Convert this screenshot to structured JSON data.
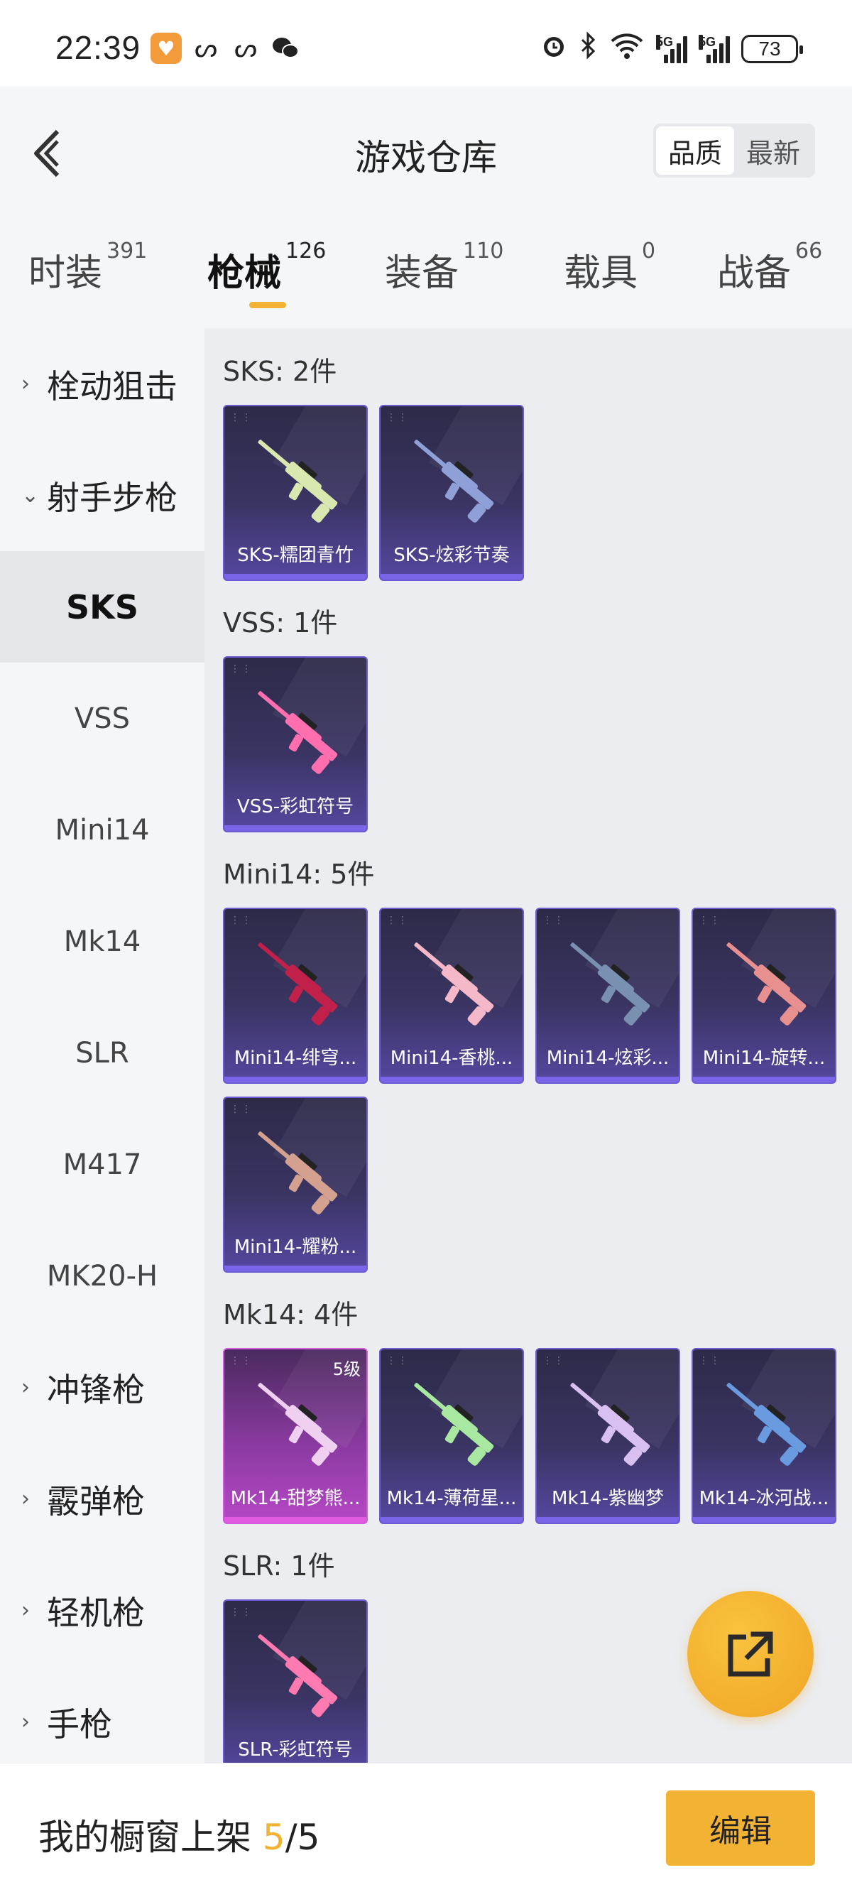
{
  "status": {
    "time": "22:39",
    "network_1": "5G",
    "network_2": "5G",
    "battery": "73"
  },
  "header": {
    "title": "游戏仓库",
    "sort_options": [
      "品质",
      "最新"
    ],
    "sort_active": "品质"
  },
  "tabs": [
    {
      "label": "时装",
      "count": "391"
    },
    {
      "label": "枪械",
      "count": "126"
    },
    {
      "label": "装备",
      "count": "110"
    },
    {
      "label": "载具",
      "count": "0"
    },
    {
      "label": "战备",
      "count": "66"
    }
  ],
  "sidebar": {
    "items": [
      {
        "label": "栓动狙击",
        "chevron": "›"
      },
      {
        "label": "射手步枪",
        "chevron": "⌄"
      },
      {
        "label": "SKS"
      },
      {
        "label": "VSS"
      },
      {
        "label": "Mini14"
      },
      {
        "label": "Mk14"
      },
      {
        "label": "SLR"
      },
      {
        "label": "M417"
      },
      {
        "label": "MK20-H"
      },
      {
        "label": "冲锋枪",
        "chevron": "›"
      },
      {
        "label": "霰弹枪",
        "chevron": "›"
      },
      {
        "label": "轻机枪",
        "chevron": "›"
      },
      {
        "label": "手枪",
        "chevron": "›"
      }
    ]
  },
  "sections": [
    {
      "title": "SKS: 2件",
      "items": [
        {
          "name": "SKS-糯团青竹",
          "color": "#d8e8b0"
        },
        {
          "name": "SKS-炫彩节奏",
          "color": "#8fa0d8"
        }
      ]
    },
    {
      "title": "VSS: 1件",
      "items": [
        {
          "name": "VSS-彩虹符号",
          "color": "#ff6fb0"
        }
      ]
    },
    {
      "title": "Mini14: 5件",
      "items": [
        {
          "name": "Mini14-绯穹...",
          "color": "#c0204a"
        },
        {
          "name": "Mini14-香桃...",
          "color": "#f4b8c8"
        },
        {
          "name": "Mini14-炫彩...",
          "color": "#7a90b0"
        },
        {
          "name": "Mini14-旋转...",
          "color": "#e89090"
        },
        {
          "name": "Mini14-耀粉...",
          "color": "#d4a090"
        }
      ]
    },
    {
      "title": "Mk14: 4件",
      "items": [
        {
          "name": "Mk14-甜梦熊...",
          "color": "#f0d0f0",
          "level": "5级"
        },
        {
          "name": "Mk14-薄荷星...",
          "color": "#a8e8a0"
        },
        {
          "name": "Mk14-紫幽梦",
          "color": "#d8c0f0"
        },
        {
          "name": "Mk14-冰河战...",
          "color": "#6a9ae0"
        }
      ]
    },
    {
      "title": "SLR: 1件",
      "items": [
        {
          "name": "SLR-彩虹符号",
          "color": "#ff7ab0"
        }
      ]
    }
  ],
  "bottom": {
    "shelf_label": "我的橱窗上架",
    "shelf_current": "5",
    "shelf_total": "/5",
    "edit_label": "编辑"
  },
  "colors": {
    "accent": "#f2b233",
    "card_purple": "#3a3462",
    "card_pink": "#b648c6"
  },
  "icons": {
    "back": "back-arrow-icon",
    "share": "share-external-icon"
  }
}
